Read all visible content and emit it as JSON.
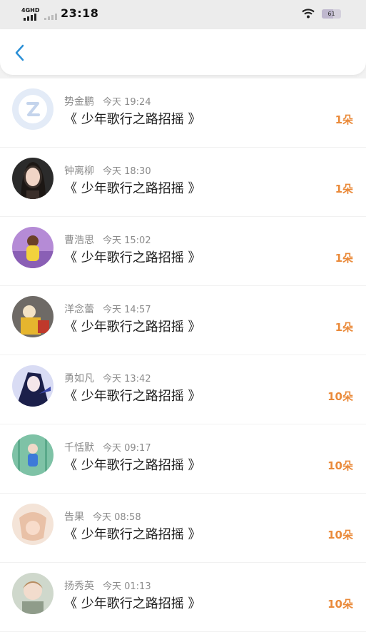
{
  "status_bar": {
    "network": "4GHD",
    "time": "23:18",
    "battery": "61"
  },
  "header": {
    "back_icon": "chevron-left-icon"
  },
  "colors": {
    "accent": "#2a8fd6",
    "count": "#ea8a3a",
    "name_gray": "#8b8b8b"
  },
  "items": [
    {
      "name": "势金鹏",
      "time": "今天 19:24",
      "title": "《 少年歌行之路招摇 》",
      "count": "1朵",
      "avatar": "default-avatar-icon"
    },
    {
      "name": "钟离柳",
      "time": "今天 18:30",
      "title": "《 少年歌行之路招摇 》",
      "count": "1朵",
      "avatar": "user-avatar"
    },
    {
      "name": "曹浩思",
      "time": "今天 15:02",
      "title": "《 少年歌行之路招摇 》",
      "count": "1朵",
      "avatar": "user-avatar"
    },
    {
      "name": "洋念蕾",
      "time": "今天 14:57",
      "title": "《 少年歌行之路招摇 》",
      "count": "1朵",
      "avatar": "user-avatar"
    },
    {
      "name": "勇如凡",
      "time": "今天 13:42",
      "title": "《 少年歌行之路招摇 》",
      "count": "10朵",
      "avatar": "user-avatar"
    },
    {
      "name": "千恬默",
      "time": "今天 09:17",
      "title": "《 少年歌行之路招摇 》",
      "count": "10朵",
      "avatar": "user-avatar"
    },
    {
      "name": "告果",
      "time": "今天 08:58",
      "title": "《 少年歌行之路招摇 》",
      "count": "10朵",
      "avatar": "user-avatar"
    },
    {
      "name": "扬秀英",
      "time": "今天 01:13",
      "title": "《 少年歌行之路招摇 》",
      "count": "10朵",
      "avatar": "user-avatar"
    }
  ]
}
